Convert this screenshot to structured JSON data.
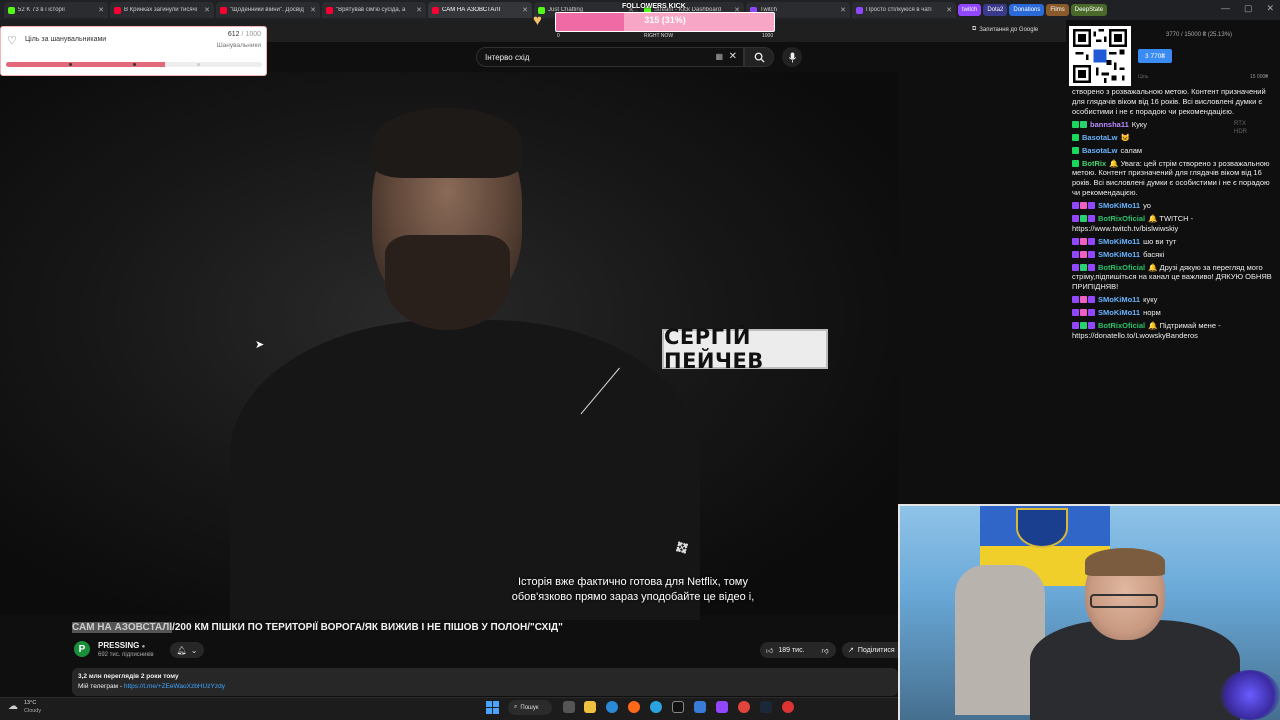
{
  "browser": {
    "tabs": [
      {
        "label": "52  K 73  в і історії",
        "type": "kick"
      },
      {
        "label": "В Кринках загинули тисячі",
        "type": "yt"
      },
      {
        "label": "\"Щоденники війни\". Досвід",
        "type": "yt"
      },
      {
        "label": "\"Врятував сім'ю сусіда, а",
        "type": "yt"
      },
      {
        "label": "САМ НА АЗОВСТАЛІ",
        "type": "yt",
        "active": true
      },
      {
        "label": "Just Chatting",
        "type": "kick"
      },
      {
        "label": "Stream - Kick Dashboard",
        "type": "kick"
      },
      {
        "label": "Twitch",
        "type": "tw"
      },
      {
        "label": "Просто стілкуюся в чаті",
        "type": "tw"
      }
    ],
    "pills": [
      {
        "label": "twitch",
        "color": "#9146ff"
      },
      {
        "label": "Dota2",
        "color": "#3a3a8a"
      },
      {
        "label": "Donations",
        "color": "#2a6ad8"
      },
      {
        "label": "Films",
        "color": "#8a5a2a"
      },
      {
        "label": "DeepState",
        "color": "#4a6a2a"
      }
    ],
    "ask_google": "Запитання до Google"
  },
  "youtube": {
    "search_query": "Інтерво схід",
    "video": {
      "name_plate": "СЕРГІЙ ПЕЙЧЕВ",
      "subtitle_line1": "Історія вже фактично готова для Netflix, тому",
      "subtitle_line2": "обов'язково прямо зараз уподобайте це відео і,"
    },
    "title_highlight": "САМ НА АЗОВСТАЛІ",
    "title_rest": "/200 КМ ПІШКИ ПО ТЕРИТОРІЇ ВОРОГА/ЯК ВИЖИВ І НЕ ПІШОВ У ПОЛОН/\"СХІД\"",
    "channel": {
      "name": "PRESSING",
      "verified_icon": "●",
      "subscribers": "692 тис. підписників",
      "avatar_letter": "P"
    },
    "likes": "189 тис.",
    "share_label": "Поділитися",
    "description": {
      "stats": "3,2 млн переглядів  2 роки тому",
      "telegram_label": "Мій телеграм - ",
      "telegram_link": "https://t.me/+ZEeWaoXzbHUzYzdy"
    }
  },
  "goal_widget": {
    "label": "Ціль за шанувальниками",
    "current": "612",
    "total": "/ 1000",
    "sub_label": "Шанувальники",
    "progress": 0.62,
    "fill_color": "#e2687a"
  },
  "followers_kick": {
    "title": "FOLLOWERS KICK",
    "value": "315 (31%)",
    "progress": 0.31,
    "min": "0",
    "now_label": "RIGHT NOW",
    "max": "1000"
  },
  "donations": {
    "progress_text": "3770 / 15000 ₴ (25.13%)",
    "amount": "3 770₴",
    "left_label": "Ціль",
    "right_label": "15 000₴"
  },
  "rtx": {
    "line1": "RTX",
    "line2": "HDR"
  },
  "chat": [
    {
      "badges": [],
      "user": "",
      "user_class": "",
      "text": "створено з розважальною метою. Контент призначений для глядачів віком від 16 років. Всі висловлені думки є особистими і не є порадою чи рекомендацією."
    },
    {
      "badges": [
        "b-kick",
        "b-green"
      ],
      "user": "bannsha11",
      "user_class": "u-purple",
      "text": "Куку"
    },
    {
      "badges": [
        "b-kick"
      ],
      "user": "BasotaLw",
      "user_class": "u-blue",
      "text": "😺"
    },
    {
      "badges": [
        "b-kick"
      ],
      "user": "BasotaLw",
      "user_class": "u-blue",
      "text": "салам"
    },
    {
      "badges": [
        "b-kick"
      ],
      "user": "BotRix",
      "user_class": "u-green",
      "text": "🔔 Увага: цей стрім створено з розважальною метою. Контент призначений для глядачів віком від 16 років. Всі висловлені думки є особистими і не є порадою чи рекомендацією."
    },
    {
      "badges": [
        "b-tw",
        "b-pink",
        "b-tw"
      ],
      "user": "SMoKiMo11",
      "user_class": "u-blue",
      "text": "уо"
    },
    {
      "badges": [
        "b-tw",
        "b-green",
        "b-tw"
      ],
      "user": "BotRixOficial",
      "user_class": "u-green2",
      "text": "🔔 TWITCH - https://www.twitch.tv/bislwiwskiy"
    },
    {
      "badges": [
        "b-tw",
        "b-pink",
        "b-tw"
      ],
      "user": "SMoKiMo11",
      "user_class": "u-blue",
      "text": "шо ви тут"
    },
    {
      "badges": [
        "b-tw",
        "b-pink",
        "b-tw"
      ],
      "user": "SMoKiMo11",
      "user_class": "u-blue",
      "text": "басякі"
    },
    {
      "badges": [
        "b-tw",
        "b-green",
        "b-tw"
      ],
      "user": "BotRixOficial",
      "user_class": "u-green2",
      "text": "🔔 Друзі дякую за перегляд мого стріму,підпишіться на канал це важливо! ДЯКУЮ ОБНЯВ ПРИПІДНЯВ!"
    },
    {
      "badges": [
        "b-tw",
        "b-pink",
        "b-tw"
      ],
      "user": "SMoKiMo11",
      "user_class": "u-blue",
      "text": "куку"
    },
    {
      "badges": [
        "b-tw",
        "b-pink",
        "b-tw"
      ],
      "user": "SMoKiMo11",
      "user_class": "u-blue",
      "text": "норм"
    },
    {
      "badges": [
        "b-tw",
        "b-green",
        "b-tw"
      ],
      "user": "BotRixOficial",
      "user_class": "u-green2",
      "text": "🔔 Підтримай мене - https://donatello.to/LwowskyBanderos"
    }
  ],
  "taskbar": {
    "weather_temp": "13°C",
    "weather_desc": "Cloudy",
    "search_label": "Пошук"
  }
}
